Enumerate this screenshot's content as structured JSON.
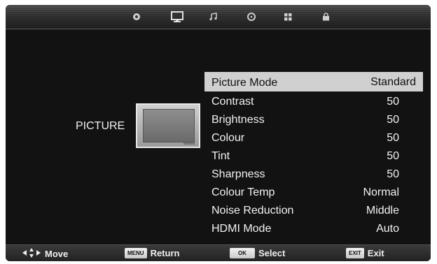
{
  "tabs": [
    {
      "icon": "settings-icon"
    },
    {
      "icon": "picture-icon"
    },
    {
      "icon": "music-note-icon"
    },
    {
      "icon": "disc-icon"
    },
    {
      "icon": "grid-icon"
    },
    {
      "icon": "lock-icon"
    }
  ],
  "section_title": "PICTURE",
  "menu": [
    {
      "label": "Picture Mode",
      "value": "Standard",
      "selected": true
    },
    {
      "label": "Contrast",
      "value": "50"
    },
    {
      "label": "Brightness",
      "value": "50"
    },
    {
      "label": "Colour",
      "value": "50"
    },
    {
      "label": "Tint",
      "value": "50"
    },
    {
      "label": "Sharpness",
      "value": "50"
    },
    {
      "label": "Colour Temp",
      "value": "Normal"
    },
    {
      "label": "Noise Reduction",
      "value": "Middle"
    },
    {
      "label": "HDMI Mode",
      "value": "Auto"
    }
  ],
  "footer": {
    "move": "Move",
    "menu_key": "MENU",
    "menu_action": "Return",
    "ok_key": "OK",
    "ok_action": "Select",
    "exit_key": "EXIT",
    "exit_action": "Exit"
  }
}
